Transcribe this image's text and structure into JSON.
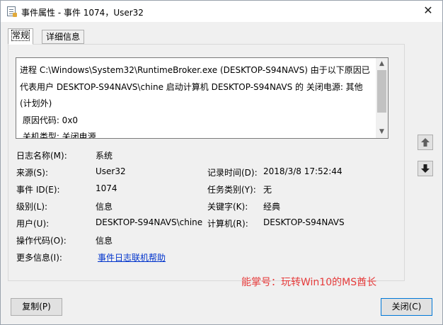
{
  "window": {
    "title": "事件属性 - 事件 1074，User32",
    "close_glyph": "✕"
  },
  "tabs": [
    {
      "label": "常规",
      "active": true
    },
    {
      "label": "详细信息",
      "active": false
    }
  ],
  "description": "进程 C:\\Windows\\System32\\RuntimeBroker.exe (DESKTOP-S94NAVS) 由于以下原因已代表用户 DESKTOP-S94NAVS\\chine 启动计算机 DESKTOP-S94NAVS 的 关闭电源: 其他(计划外)\n 原因代码: 0x0\n 关机类型: 关闭电源",
  "fields": {
    "log_name": {
      "label": "日志名称(M):",
      "value": "系统"
    },
    "source": {
      "label": "来源(S):",
      "value": "User32"
    },
    "logged": {
      "label": "记录时间(D):",
      "value": "2018/3/8 17:52:44"
    },
    "event_id": {
      "label": "事件 ID(E):",
      "value": "1074"
    },
    "task_category": {
      "label": "任务类别(Y):",
      "value": "无"
    },
    "level": {
      "label": "级别(L):",
      "value": "信息"
    },
    "keywords": {
      "label": "关键字(K):",
      "value": "经典"
    },
    "user": {
      "label": "用户(U):",
      "value": "DESKTOP-S94NAVS\\chine"
    },
    "computer": {
      "label": "计算机(R):",
      "value": "DESKTOP-S94NAVS"
    },
    "opcode": {
      "label": "操作代码(O):",
      "value": "信息"
    },
    "more_info": {
      "label": "更多信息(I):",
      "link": "事件日志联机帮助"
    }
  },
  "buttons": {
    "copy": "复制(P)",
    "close": "关闭(C)"
  },
  "watermark": "能掌号：玩转Win10的MS酋长",
  "icons": {
    "scroll_up": "▲",
    "scroll_down": "▼"
  }
}
